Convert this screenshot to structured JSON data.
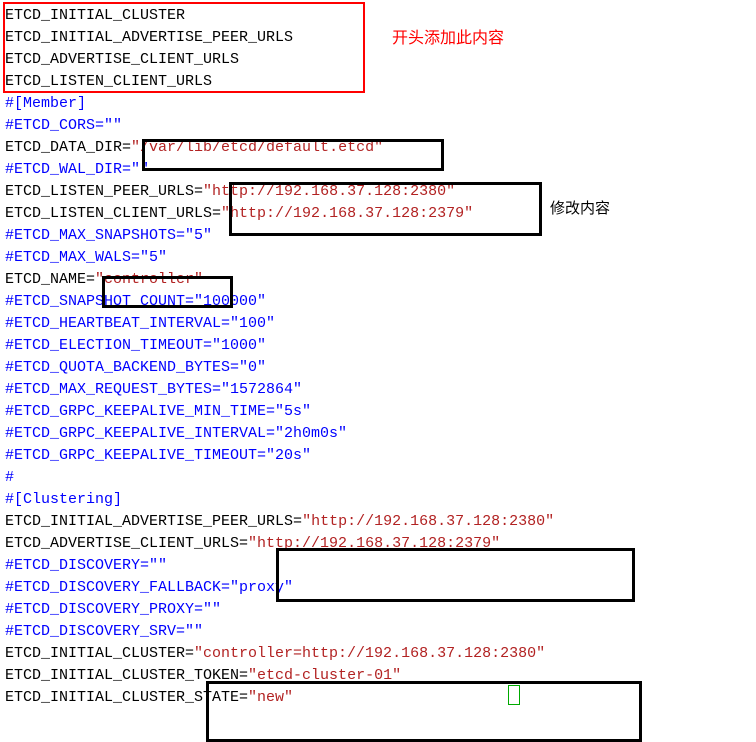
{
  "annotations": {
    "top": "开头添加此内容",
    "modify": "修改内容"
  },
  "lines": {
    "l01": "ETCD_INITIAL_CLUSTER",
    "l02": "ETCD_INITIAL_ADVERTISE_PEER_URLS",
    "l03": "ETCD_ADVERTISE_CLIENT_URLS",
    "l04": "ETCD_LISTEN_CLIENT_URLS",
    "l05": "#[Member]",
    "l06": "#ETCD_CORS=\"\"",
    "l07a": "ETCD_DATA_DIR=",
    "l07b": "\"/var/lib/etcd/default.etcd\"",
    "l08": "#ETCD_WAL_DIR=\"\"",
    "l09a": "ETCD_LISTEN_PEER_URLS=",
    "l09b": "\"http://192.168.37.128:2380\"",
    "l10a": "ETCD_LISTEN_CLIENT_URLS=",
    "l10b": "\"http://192.168.37.128:2379\"",
    "l11": "#ETCD_MAX_SNAPSHOTS=\"5\"",
    "l12": "#ETCD_MAX_WALS=\"5\"",
    "l13a": "ETCD_NAME=",
    "l13b": "\"controller\"",
    "l14": "#ETCD_SNAPSHOT_COUNT=\"100000\"",
    "l15": "#ETCD_HEARTBEAT_INTERVAL=\"100\"",
    "l16": "#ETCD_ELECTION_TIMEOUT=\"1000\"",
    "l17": "#ETCD_QUOTA_BACKEND_BYTES=\"0\"",
    "l18": "#ETCD_MAX_REQUEST_BYTES=\"1572864\"",
    "l19": "#ETCD_GRPC_KEEPALIVE_MIN_TIME=\"5s\"",
    "l20": "#ETCD_GRPC_KEEPALIVE_INTERVAL=\"2h0m0s\"",
    "l21": "#ETCD_GRPC_KEEPALIVE_TIMEOUT=\"20s\"",
    "l22": "#",
    "l23": "#[Clustering]",
    "l24a": "ETCD_INITIAL_ADVERTISE_PEER_URLS=",
    "l24b": "\"http://192.168.37.128:2380\"",
    "l25a": "ETCD_ADVERTISE_CLIENT_URLS=",
    "l25b": "\"http://192.168.37.128:2379\"",
    "l26": "#ETCD_DISCOVERY=\"\"",
    "l27": "#ETCD_DISCOVERY_FALLBACK=\"proxy\"",
    "l28": "#ETCD_DISCOVERY_PROXY=\"\"",
    "l29": "#ETCD_DISCOVERY_SRV=\"\"",
    "l30a": "ETCD_INITIAL_CLUSTER=",
    "l30b": "\"controller=http://192.168.37.128:2380\"",
    "l31a": "ETCD_INITIAL_CLUSTER_TOKEN=",
    "l31b": "\"etcd-cluster-01\"",
    "l32a": "ETCD_INITIAL_CLUSTER_STATE=",
    "l32b": "\"new\""
  }
}
